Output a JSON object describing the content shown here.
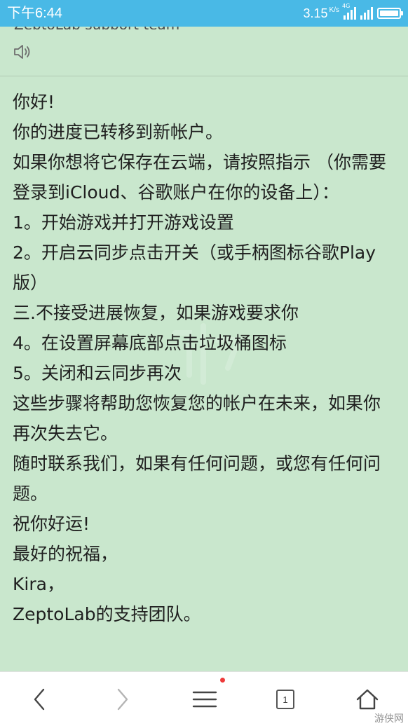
{
  "status_bar": {
    "time": "下午6:44",
    "speed_value": "3.15",
    "speed_unit": "K/s",
    "network_tag": "4G",
    "background_color": "#49b9e6"
  },
  "header": {
    "truncated_title": "ZeptoLab support team",
    "speaker_icon": "speaker-icon"
  },
  "message": {
    "lines": [
      "你好!",
      "你的进度已转移到新帐户。",
      "如果你想将它保存在云端，请按照指示 （你需要登录到iCloud、谷歌账户在你的设备上）：",
      "1。开始游戏并打开游戏设置",
      "2。开启云同步点击开关（或手柄图标谷歌Play版）",
      "三.不接受进展恢复，如果游戏要求你",
      "4。在设置屏幕底部点击垃圾桶图标",
      "5。关闭和云同步再次",
      "这些步骤将帮助您恢复您的帐户在未来，如果你再次失去它。",
      "随时联系我们，如果有任何问题，或您有任何问题。",
      "祝你好运!",
      "最好的祝福，",
      "Kira，",
      "ZeptoLab的支持团队。"
    ],
    "text_color": "#1f1f1f",
    "background_color": "#c9e7cd"
  },
  "bottom_nav": {
    "back_icon": "chevron-left-icon",
    "forward_icon": "chevron-right-icon",
    "menu_icon": "menu-icon",
    "tab_count": "1",
    "home_icon": "home-icon",
    "notification_dot_color": "#ee3a3a"
  },
  "watermark_text": "游侠网"
}
